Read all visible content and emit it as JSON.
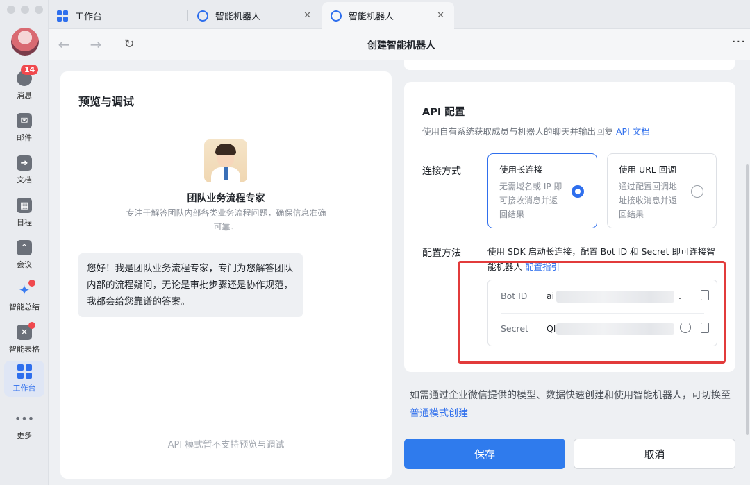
{
  "rail": {
    "messages_badge": "14",
    "items": [
      {
        "label": "消息"
      },
      {
        "label": "邮件"
      },
      {
        "label": "文档"
      },
      {
        "label": "日程"
      },
      {
        "label": "会议"
      },
      {
        "label": "智能总结"
      },
      {
        "label": "智能表格"
      },
      {
        "label": "工作台"
      },
      {
        "label": "更多"
      }
    ]
  },
  "tabs": [
    {
      "label": "工作台"
    },
    {
      "label": "智能机器人"
    },
    {
      "label": "智能机器人"
    }
  ],
  "nav": {
    "title": "创建智能机器人"
  },
  "preview": {
    "title": "预览与调试",
    "bot_name": "团队业务流程专家",
    "bot_desc": "专注于解答团队内部各类业务流程问题，确保信息准确可靠。",
    "message": "您好！我是团队业务流程专家，专门为您解答团队内部的流程疑问，无论是审批步骤还是协作规范，我都会给您靠谱的答案。",
    "api_note": "API 模式暂不支持预览与调试"
  },
  "api": {
    "title": "API 配置",
    "subtitle": "使用自有系统获取成员与机器人的聊天并输出回复",
    "subtitle_link": "API 文档",
    "connect_label": "连接方式",
    "options": [
      {
        "title": "使用长连接",
        "desc": "无需域名或 IP 即可接收消息并返回结果",
        "selected": true
      },
      {
        "title": "使用 URL 回调",
        "desc": "通过配置回调地址接收消息并返回结果",
        "selected": false
      }
    ],
    "config_label": "配置方法",
    "config_desc": "使用 SDK 启动长连接，配置 Bot ID 和 Secret 即可连接智能机器人",
    "config_link": "配置指引",
    "bot_id_key": "Bot ID",
    "bot_id_value_prefix": "ai",
    "bot_id_value_suffix": ".",
    "secret_key": "Secret",
    "secret_value_prefix": "Ql"
  },
  "footer": {
    "switch_text": "如需通过企业微信提供的模型、数据快速创建和使用智能机器人，可切换至",
    "switch_link": "普通模式创建",
    "save": "保存",
    "cancel": "取消"
  },
  "colors": {
    "accent": "#2f6fed",
    "highlight": "#e23b3b",
    "badge": "#f0494e"
  }
}
